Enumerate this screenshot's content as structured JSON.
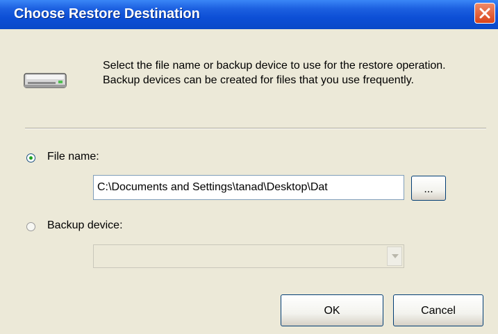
{
  "window": {
    "title": "Choose Restore Destination"
  },
  "intro": {
    "text": "Select the file name or backup device to use for the restore operation.  Backup devices can be created for files that you use frequently."
  },
  "options": {
    "file_name": {
      "label": "File name:",
      "selected": true,
      "value": "C:\\Documents and Settings\\tanad\\Desktop\\Dat",
      "browse_label": "..."
    },
    "backup_device": {
      "label": "Backup device:",
      "selected": false,
      "value": ""
    }
  },
  "buttons": {
    "ok_label": "OK",
    "cancel_label": "Cancel"
  },
  "icons": {
    "close": "close-icon",
    "device": "tape-drive-icon",
    "dropdown": "chevron-down-icon"
  },
  "colors": {
    "titlebar": "#0a49c8",
    "dialog_bg": "#ece9d8",
    "close_button": "#d9431a",
    "radio_dot": "#21a121"
  }
}
